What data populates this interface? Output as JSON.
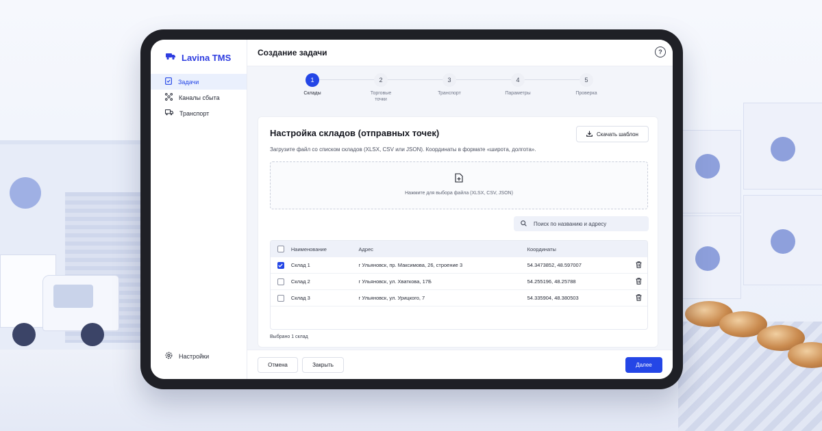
{
  "app": {
    "name": "Lavina TMS"
  },
  "sidebar": {
    "items": [
      {
        "label": "Задачи",
        "icon": "task-icon",
        "active": true
      },
      {
        "label": "Каналы сбыта",
        "icon": "channels-icon",
        "active": false
      },
      {
        "label": "Транспорт",
        "icon": "truck-icon",
        "active": false
      }
    ],
    "settings_label": "Настройки"
  },
  "header": {
    "title": "Создание задачи",
    "help_icon": "?"
  },
  "stepper": {
    "steps": [
      {
        "number": "1",
        "label": "Склады",
        "active": true
      },
      {
        "number": "2",
        "label": "Торговые точки",
        "active": false
      },
      {
        "number": "3",
        "label": "Транспорт",
        "active": false
      },
      {
        "number": "4",
        "label": "Параметры",
        "active": false
      },
      {
        "number": "5",
        "label": "Проверка",
        "active": false
      }
    ]
  },
  "card": {
    "title": "Настройка складов (отправных точек)",
    "subtitle": "Загрузите файл со списком складов (XLSX, CSV или JSON). Координаты в формате «широта, долгота».",
    "download_label": "Скачать шаблон",
    "dropzone_text": "Нажмите для выбора файла (XLSX, CSV, JSON)",
    "search_placeholder": "Поиск по названию и адресу"
  },
  "table": {
    "columns": {
      "name": "Наименование",
      "address": "Адрес",
      "coords": "Координаты"
    },
    "rows": [
      {
        "checked": true,
        "name": "Склад 1",
        "address": "г Ульяновск, пр. Максимова, 26, строение 3",
        "coords": "54.3473852, 48.597007"
      },
      {
        "checked": false,
        "name": "Склад 2",
        "address": "г Ульяновск, ул. Хваткова, 17Б",
        "coords": "54.255196, 48.25788"
      },
      {
        "checked": false,
        "name": "Склад 3",
        "address": "г Ульяновск, ул. Урицкого, 7",
        "coords": "54.335904, 48.380503"
      }
    ],
    "selected_text": "Выбрано 1 склад"
  },
  "footer": {
    "cancel_label": "Отмена",
    "close_label": "Закрыть",
    "next_label": "Далее"
  },
  "colors": {
    "accent": "#2446e6",
    "bezel": "#1f2026",
    "background": "#eef2fb"
  }
}
